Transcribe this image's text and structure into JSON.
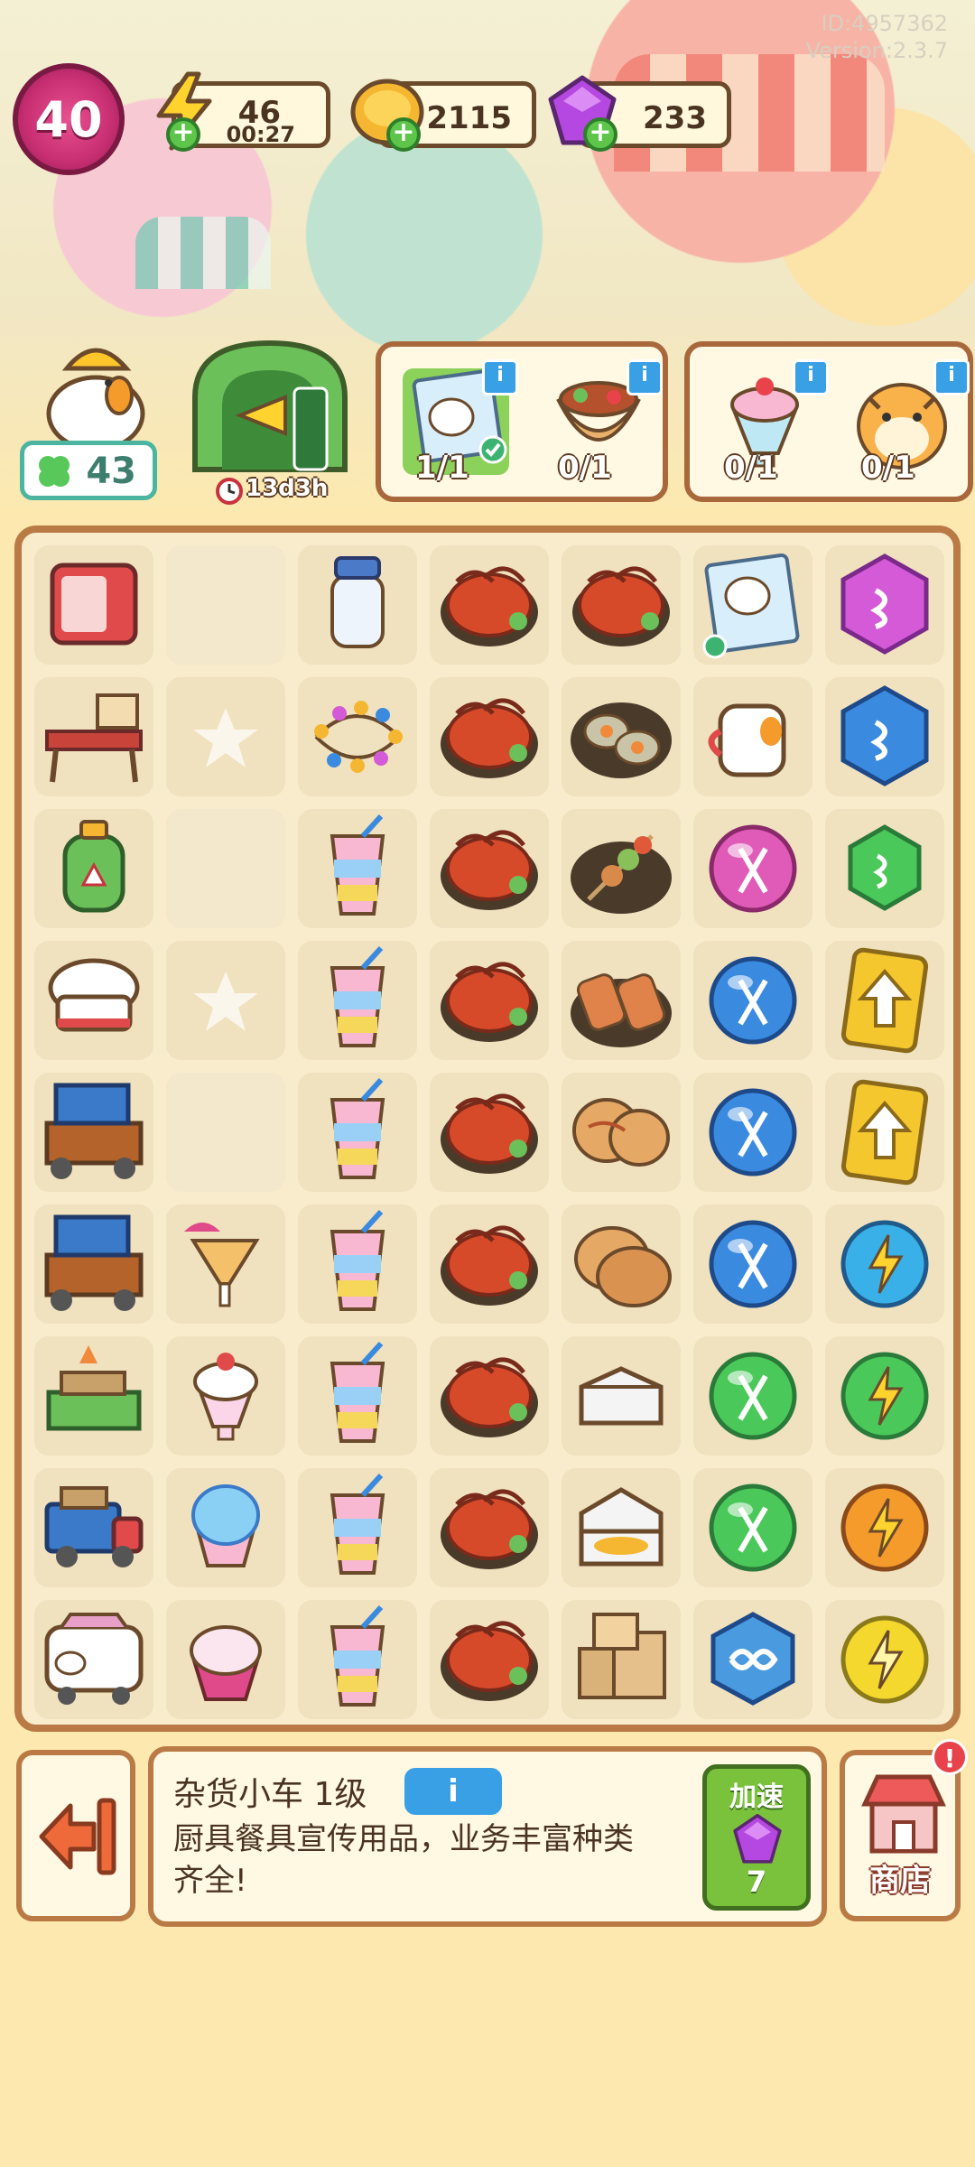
{
  "meta": {
    "id": "ID:4957362",
    "version": "Version:2.3.7"
  },
  "top": {
    "level": "40",
    "energy": {
      "value": "46",
      "timer": "00:27"
    },
    "coins": {
      "value": "2115"
    },
    "gems": {
      "value": "233"
    },
    "chicken_stars": "43",
    "event": {
      "timer": "13d3h"
    }
  },
  "orders": [
    {
      "count": "1/1",
      "icon": "chicken-poster-icon",
      "completed": true
    },
    {
      "count": "0/1",
      "icon": "wrap-icon"
    },
    {
      "count": "0/1",
      "icon": "sundae-icon"
    },
    {
      "count": "0/1",
      "icon": "tiger-icon"
    }
  ],
  "board": {
    "rows": [
      [
        "fridge",
        "",
        "milk-bottle",
        "crayfish",
        "crayfish",
        "chicken-poster",
        "pink-hex-gem"
      ],
      [
        "picnic-table",
        "star-slot",
        "fairy-lights",
        "crayfish",
        "oyster-plate",
        "chicken-mug",
        "blue-hex-gem"
      ],
      [
        "gas-tank",
        "",
        "layered-drink",
        "crayfish",
        "skewer-plate",
        "pink-scissors-bubble",
        "green-hex-gem"
      ],
      [
        "chef-hat",
        "star-slot",
        "layered-drink",
        "crayfish",
        "meat-skewers",
        "blue-scissors-bubble",
        "upgrade-card"
      ],
      [
        "grill-cart",
        "",
        "layered-drink",
        "crayfish",
        "flatbread-rolls",
        "blue-scissors-bubble",
        "upgrade-card"
      ],
      [
        "grill-cart",
        "cocktail",
        "layered-drink",
        "crayfish",
        "flatbread",
        "blue-scissors-bubble",
        "blue-energy-orb"
      ],
      [
        "noodle-stand",
        "ice-cream-sundae",
        "layered-drink",
        "crayfish",
        "takeout-box",
        "green-scissors-bubble",
        "green-energy-orb"
      ],
      [
        "delivery-truck",
        "shaved-ice",
        "layered-drink",
        "crayfish",
        "takeout-box-food",
        "green-scissors-bubble",
        "orange-energy-orb"
      ],
      [
        "food-van",
        "ice-cream-cup",
        "layered-drink",
        "crayfish",
        "cardboard-boxes",
        "infinity-hex",
        "yellow-energy-orb"
      ]
    ]
  },
  "bottom": {
    "item_title": "杂货小车 1级",
    "item_desc": "厨具餐具宣传用品，业务丰富种类齐全!",
    "speed_up_label": "加速",
    "speed_up_cost": "7",
    "shop_label": "商店"
  }
}
